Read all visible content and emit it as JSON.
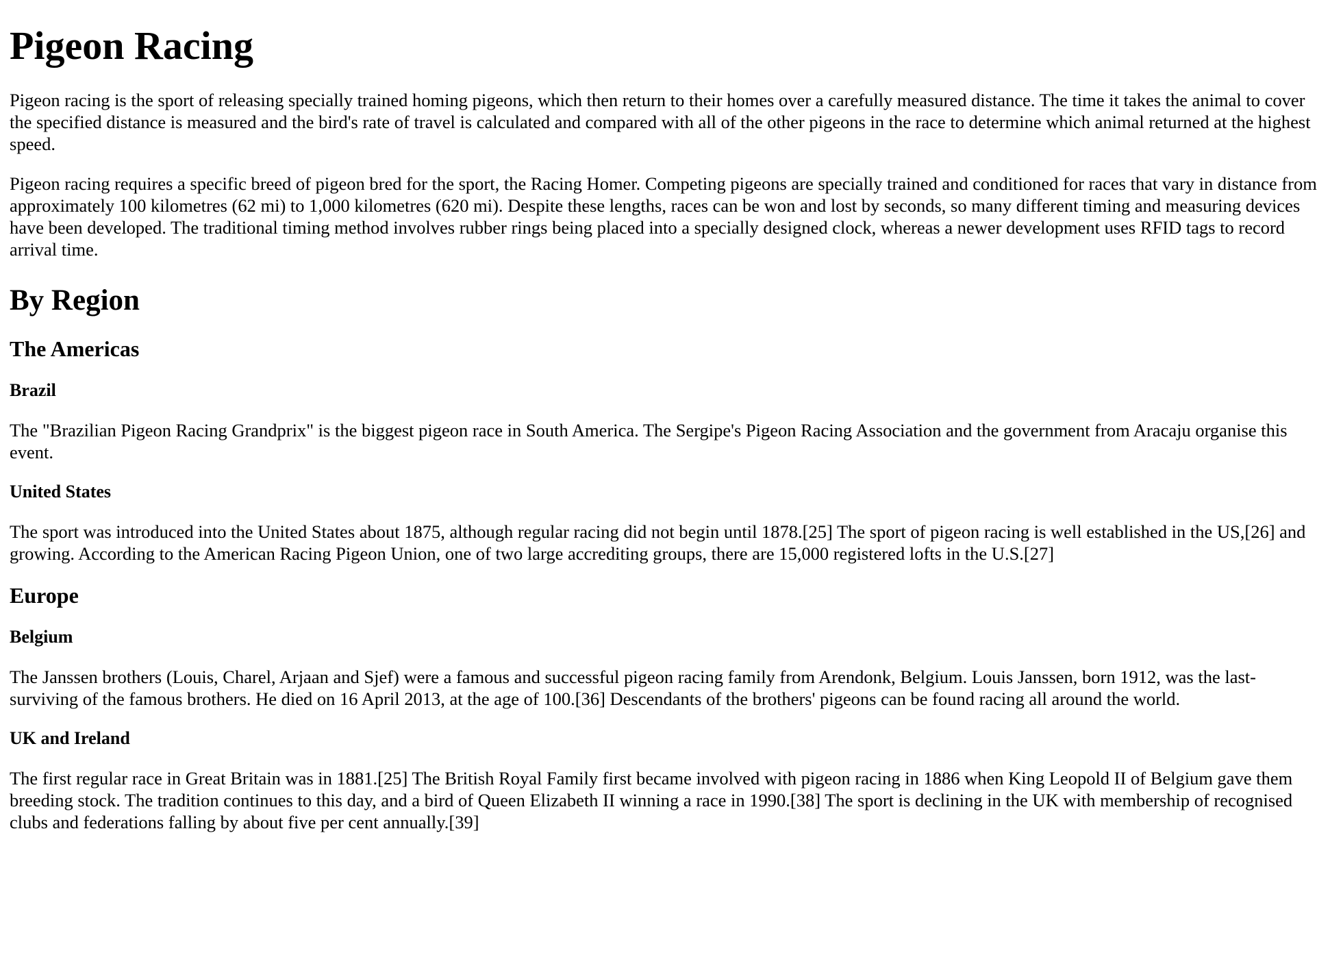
{
  "article": {
    "title": "Pigeon Racing",
    "intro": [
      "Pigeon racing is the sport of releasing specially trained homing pigeons, which then return to their homes over a carefully measured distance. The time it takes the animal to cover the specified distance is measured and the bird's rate of travel is calculated and compared with all of the other pigeons in the race to determine which animal returned at the highest speed.",
      "Pigeon racing requires a specific breed of pigeon bred for the sport, the Racing Homer. Competing pigeons are specially trained and conditioned for races that vary in distance from approximately 100 kilometres (62 mi) to 1,000 kilometres (620 mi). Despite these lengths, races can be won and lost by seconds, so many different timing and measuring devices have been developed. The traditional timing method involves rubber rings being placed into a specially designed clock, whereas a newer development uses RFID tags to record arrival time."
    ],
    "by_region": {
      "heading": "By Region",
      "americas": {
        "heading": "The Americas",
        "brazil": {
          "heading": "Brazil",
          "text": "The \"Brazilian Pigeon Racing Grandprix\" is the biggest pigeon race in South America. The Sergipe's Pigeon Racing Association and the government from Aracaju organise this event."
        },
        "united_states": {
          "heading": "United States",
          "text": "The sport was introduced into the United States about 1875, although regular racing did not begin until 1878.[25] The sport of pigeon racing is well established in the US,[26] and growing. According to the American Racing Pigeon Union, one of two large accrediting groups, there are 15,000 registered lofts in the U.S.[27]"
        }
      },
      "europe": {
        "heading": "Europe",
        "belgium": {
          "heading": "Belgium",
          "text": "The Janssen brothers (Louis, Charel, Arjaan and Sjef) were a famous and successful pigeon racing family from Arendonk, Belgium. Louis Janssen, born 1912, was the last-surviving of the famous brothers. He died on 16 April 2013, at the age of 100.[36] Descendants of the brothers' pigeons can be found racing all around the world."
        },
        "uk_ireland": {
          "heading": "UK and Ireland",
          "text": "The first regular race in Great Britain was in 1881.[25] The British Royal Family first became involved with pigeon racing in 1886 when King Leopold II of Belgium gave them breeding stock. The tradition continues to this day, and a bird of Queen Elizabeth II winning a race in 1990.[38] The sport is declining in the UK with membership of recognised clubs and federations falling by about five per cent annually.[39]"
        }
      }
    }
  }
}
